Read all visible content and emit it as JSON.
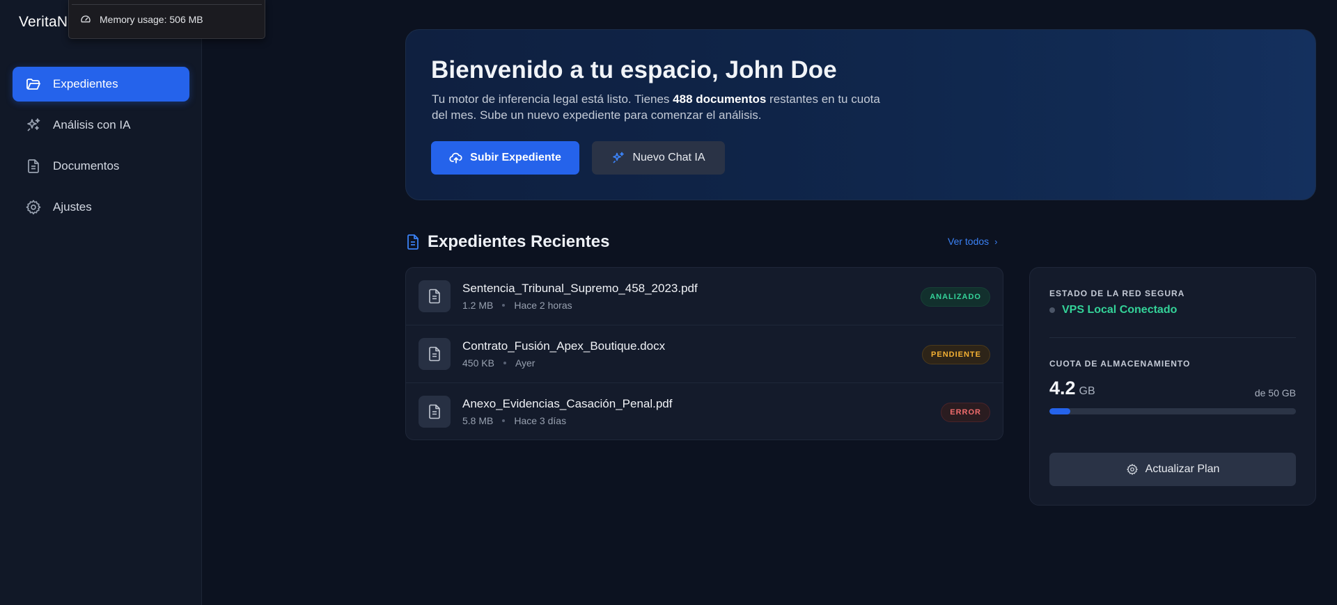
{
  "app": {
    "brand": "VeritaN"
  },
  "tooltip": {
    "text": "Memory usage: 506 MB",
    "icon": "gauge-icon"
  },
  "sidebar": {
    "items": [
      {
        "label": "Expedientes",
        "icon": "folder-open-icon",
        "active": true
      },
      {
        "label": "Análisis con IA",
        "icon": "sparkles-icon",
        "active": false
      },
      {
        "label": "Documentos",
        "icon": "document-icon",
        "active": false
      },
      {
        "label": "Ajustes",
        "icon": "gear-icon",
        "active": false
      }
    ]
  },
  "hero": {
    "title": "Bienvenido a tu espacio, John Doe",
    "subtitle_before": "Tu motor de inferencia legal está listo. Tienes ",
    "subtitle_bold": "488 documentos",
    "subtitle_after": " restantes en tu cuota del mes. Sube un nuevo expediente para comenzar el análisis.",
    "primary_button": "Subir Expediente",
    "secondary_button": "Nuevo Chat IA"
  },
  "recent": {
    "title": "Expedientes Recientes",
    "see_all": "Ver todos",
    "files": [
      {
        "name": "Sentencia_Tribunal_Supremo_458_2023.pdf",
        "size": "1.2 MB",
        "time": "Hace 2 horas",
        "status": "ANALIZADO",
        "status_color": "#34d399"
      },
      {
        "name": "Contrato_Fusión_Apex_Boutique.docx",
        "size": "450 KB",
        "time": "Ayer",
        "status": "PENDIENTE",
        "status_color": "#f5b133"
      },
      {
        "name": "Anexo_Evidencias_Casación_Penal.pdf",
        "size": "5.8 MB",
        "time": "Hace 3 días",
        "status": "ERROR",
        "status_color": "#f26d6d"
      }
    ]
  },
  "status_card": {
    "network_label": "ESTADO DE LA RED SEGURA",
    "network_status": "VPS Local Conectado",
    "storage_label": "CUOTA DE ALMACENAMIENTO",
    "storage_used": "4.2",
    "storage_unit": "GB",
    "storage_total": "de 50 GB",
    "storage_fraction": 0.084,
    "upgrade_button": "Actualizar Plan"
  },
  "colors": {
    "accent": "#2563eb",
    "background": "#0c1220",
    "success": "#34d399"
  }
}
